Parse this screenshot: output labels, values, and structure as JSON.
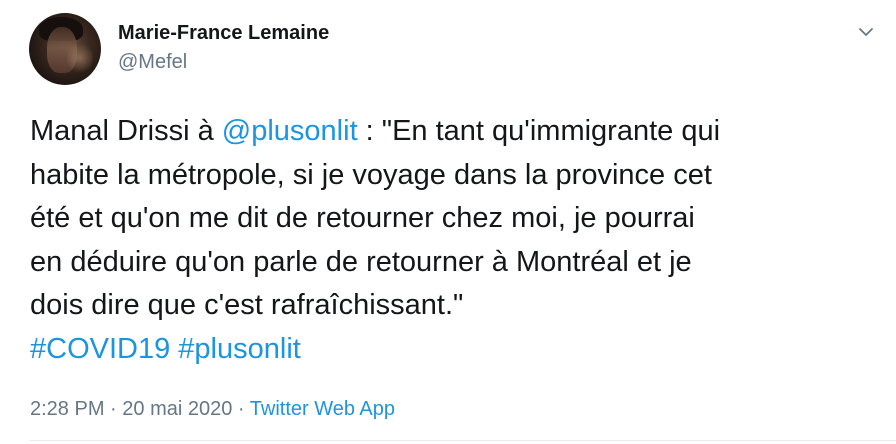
{
  "author": {
    "display_name": "Marie-France Lemaine",
    "handle": "@Mefel"
  },
  "tweet": {
    "line1_pre": "Manal Drissi à ",
    "mention": "@plusonlit",
    "line1_post": " : \"En tant qu'immigrante qui",
    "line2": "habite la métropole, si je voyage dans la province cet",
    "line3": "été et qu'on me dit de retourner chez moi, je pourrai",
    "line4": "en déduire qu'on parle de retourner à Montréal et je",
    "line5": "dois dire que c'est rafraîchissant.\"",
    "hashtag1": "#COVID19",
    "hashtag2": "#plusonlit"
  },
  "meta": {
    "time": "2:28 PM",
    "separator": " · ",
    "date": "20 mai 2020",
    "separator2": " · ",
    "source": "Twitter Web App"
  },
  "icons": {
    "caret": "chevron-down-icon"
  },
  "colors": {
    "link": "#1b95e0",
    "secondary_text": "#657786",
    "primary_text": "#14171a"
  }
}
